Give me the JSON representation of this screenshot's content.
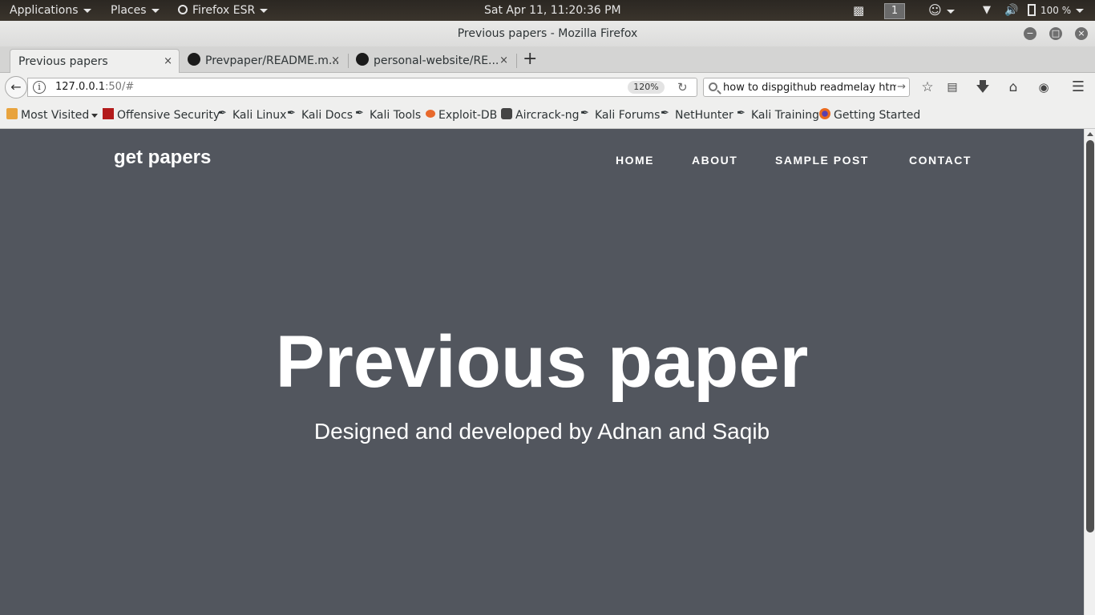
{
  "topbar": {
    "applications": "Applications",
    "places": "Places",
    "app_name": "Firefox ESR",
    "clock": "Sat Apr 11, 11:20:36 PM",
    "workspace": "1",
    "battery": "100 %"
  },
  "window": {
    "title": "Previous papers - Mozilla Firefox"
  },
  "tabs": [
    {
      "label": "Previous papers",
      "close": "×"
    },
    {
      "label": "Prevpaper/README.m...",
      "close": "×"
    },
    {
      "label": "personal-website/RE...",
      "close": "×"
    }
  ],
  "new_tab": "+",
  "nav": {
    "url_host": "127.0.0.1",
    "url_rest": ":50/#",
    "zoom": "120%",
    "search_value": "how to dispgithub readmelay html"
  },
  "bookmarks": [
    {
      "label": "Most Visited",
      "icon": "folder-icon"
    },
    {
      "label": "Offensive Security",
      "icon": "offsec-icon"
    },
    {
      "label": "Kali Linux",
      "icon": "kali-dragon-icon"
    },
    {
      "label": "Kali Docs",
      "icon": "kali-dragon-icon"
    },
    {
      "label": "Kali Tools",
      "icon": "kali-dragon-icon"
    },
    {
      "label": "Exploit-DB",
      "icon": "exploitdb-icon"
    },
    {
      "label": "Aircrack-ng",
      "icon": "aircrack-icon"
    },
    {
      "label": "Kali Forums",
      "icon": "kali-dragon-icon"
    },
    {
      "label": "NetHunter",
      "icon": "kali-dragon-icon"
    },
    {
      "label": "Kali Training",
      "icon": "kali-dragon-icon"
    },
    {
      "label": "Getting Started",
      "icon": "firefox-icon"
    }
  ],
  "site": {
    "brand": "get papers",
    "nav": [
      "HOME",
      "ABOUT",
      "SAMPLE POST",
      "CONTACT"
    ],
    "hero_title": "Previous paper",
    "hero_subtitle": "Designed and developed by Adnan and Saqib"
  },
  "colors": {
    "page_bg": "#52565e",
    "text": "#ffffff"
  }
}
